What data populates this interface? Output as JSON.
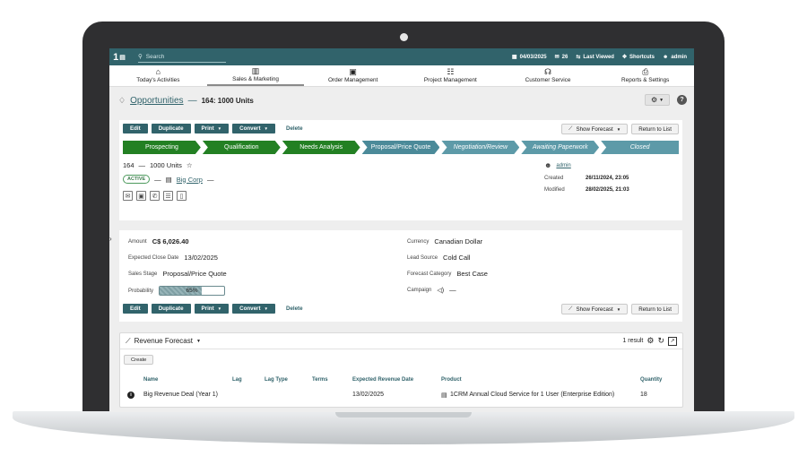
{
  "topbar": {
    "search_placeholder": "Search",
    "date": "04/03/2025",
    "mail_count": "26",
    "last_viewed": "Last Viewed",
    "shortcuts": "Shortcuts",
    "user": "admin"
  },
  "nav": [
    {
      "label": "Today's Activities",
      "icon": "home-icon",
      "active": false
    },
    {
      "label": "Sales & Marketing",
      "icon": "columns-icon",
      "active": true
    },
    {
      "label": "Order Management",
      "icon": "clipboard-icon",
      "active": false
    },
    {
      "label": "Project Management",
      "icon": "tasks-icon",
      "active": false
    },
    {
      "label": "Customer Service",
      "icon": "headset-icon",
      "active": false
    },
    {
      "label": "Reports & Settings",
      "icon": "printer-icon",
      "active": false
    }
  ],
  "title": {
    "module": "Opportunities",
    "separator": "—",
    "record": "164: 1000 Units"
  },
  "actions": {
    "edit": "Edit",
    "duplicate": "Duplicate",
    "print": "Print",
    "convert": "Convert",
    "delete": "Delete",
    "show_forecast": "Show Forecast",
    "return": "Return to List"
  },
  "stages": [
    {
      "label": "Prospecting",
      "state": "done"
    },
    {
      "label": "Qualification",
      "state": "done"
    },
    {
      "label": "Needs Analysis",
      "state": "done"
    },
    {
      "label": "Proposal/Price Quote",
      "state": "cur"
    },
    {
      "label": "Negotiation/Review",
      "state": "next"
    },
    {
      "label": "Awaiting Paperwork",
      "state": "next"
    },
    {
      "label": "Closed",
      "state": "next"
    }
  ],
  "record": {
    "number": "164",
    "dash": "—",
    "name": "1000 Units",
    "status": "ACTIVE",
    "account": "Big Corp",
    "assigned": "admin",
    "created_label": "Created",
    "created": "26/11/2024, 23:05",
    "modified_label": "Modified",
    "modified": "28/02/2025, 21:03"
  },
  "fields": {
    "amount_label": "Amount",
    "amount": "C$ 6,026.40",
    "currency_label": "Currency",
    "currency": "Canadian Dollar",
    "close_label": "Expected Close Date",
    "close": "13/02/2025",
    "source_label": "Lead Source",
    "source": "Cold Call",
    "stage_label": "Sales Stage",
    "stage": "Proposal/Price Quote",
    "forecast_label": "Forecast Category",
    "forecast": "Best Case",
    "prob_label": "Probability",
    "prob": "65%",
    "prob_value": 0.65,
    "campaign_label": "Campaign",
    "campaign": "—"
  },
  "forecast": {
    "title": "Revenue Forecast",
    "result": "1 result",
    "create": "Create",
    "headers": [
      "Name",
      "Lag",
      "Lag Type",
      "Terms",
      "Expected Revenue Date",
      "Product",
      "Quantity"
    ],
    "row": {
      "name": "Big Revenue Deal (Year 1)",
      "date": "13/02/2025",
      "product": "1CRM Annual Cloud Service for 1 User (Enterprise Edition)",
      "qty": "18"
    }
  },
  "colors": {
    "accent": "#31636b",
    "stage_done": "#238023",
    "stage_open": "#5d9aa8"
  }
}
